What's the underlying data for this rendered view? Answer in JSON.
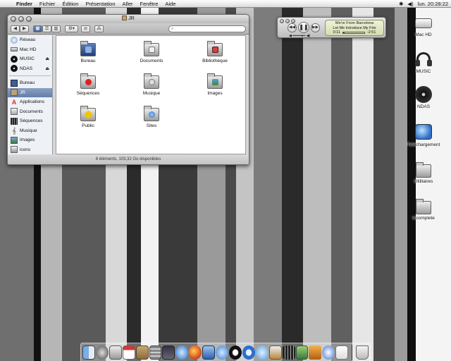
{
  "menubar": {
    "apple_glyph": "",
    "items": [
      "Finder",
      "Fichier",
      "Édition",
      "Présentation",
      "Aller",
      "Fenêtre",
      "Aide"
    ],
    "status_icons": [
      "bluetooth-icon",
      "volume-icon"
    ],
    "clock": "lun. 20:28:22"
  },
  "finder": {
    "title": "JR",
    "search_placeholder": "",
    "sidebar": {
      "devices": [
        {
          "label": "Réseau",
          "icon": "network-icon"
        },
        {
          "label": "Mac HD",
          "icon": "hard-drive-icon"
        },
        {
          "label": "MUSIC",
          "icon": "disk-icon",
          "eject": "⏏"
        },
        {
          "label": "NDAS",
          "icon": "disk-icon",
          "eject": "⏏"
        }
      ],
      "places": [
        {
          "label": "Bureau",
          "icon": "desktop-icon"
        },
        {
          "label": "JR",
          "icon": "home-icon"
        },
        {
          "label": "Applications",
          "icon": "applications-icon"
        },
        {
          "label": "Documents",
          "icon": "documents-icon"
        },
        {
          "label": "Séquences",
          "icon": "film-icon"
        },
        {
          "label": "Musique",
          "icon": "music-note-icon"
        },
        {
          "label": "Images",
          "icon": "images-icon"
        },
        {
          "label": "icons",
          "icon": "folder-icon"
        }
      ]
    },
    "items": [
      {
        "label": "Bureau",
        "icon": "desktop-folder-icon"
      },
      {
        "label": "Documents",
        "icon": "documents-folder-icon"
      },
      {
        "label": "Bibliothèque",
        "icon": "library-folder-icon"
      },
      {
        "label": "Séquences",
        "icon": "movies-folder-icon"
      },
      {
        "label": "Musique",
        "icon": "music-folder-icon"
      },
      {
        "label": "Images",
        "icon": "pictures-folder-icon"
      },
      {
        "label": "Public",
        "icon": "public-folder-icon"
      },
      {
        "label": "Sites",
        "icon": "sites-folder-icon"
      }
    ],
    "status": "8 éléments, 103,32 Go disponibles"
  },
  "itunes": {
    "artist": "We're From Barcelona",
    "song": "Let Me Introduce My Frie",
    "elapsed": "0:11",
    "remaining": "-2:51",
    "progress": 0.06
  },
  "desktop": [
    {
      "label": "Mac HD",
      "icon": "hard-drive-icon"
    },
    {
      "label": "MUSIC",
      "icon": "headphones-icon"
    },
    {
      "label": "NDAS",
      "icon": "disk-icon"
    },
    {
      "label": "Téléchargement",
      "icon": "download-globe-icon"
    },
    {
      "label": "Utilitaires",
      "icon": "folder-icon"
    },
    {
      "label": "Incomplete",
      "icon": "folder-icon"
    }
  ],
  "dock": {
    "items": [
      "finder-icon",
      "dashboard-icon",
      "mail-icon",
      "ical-icon",
      "address-book-icon",
      "calculator-icon",
      "dictionary-icon",
      "safari-icon",
      "firefox-icon",
      "xcode-icon",
      "network-utility-icon",
      "skype-icon",
      "quicktime-icon",
      "itunes-icon",
      "preview-icon",
      "imovie-icon",
      "iphoto-icon",
      "garageband-icon",
      "camino-icon",
      "textedit-icon"
    ],
    "trash": "trash-icon"
  }
}
